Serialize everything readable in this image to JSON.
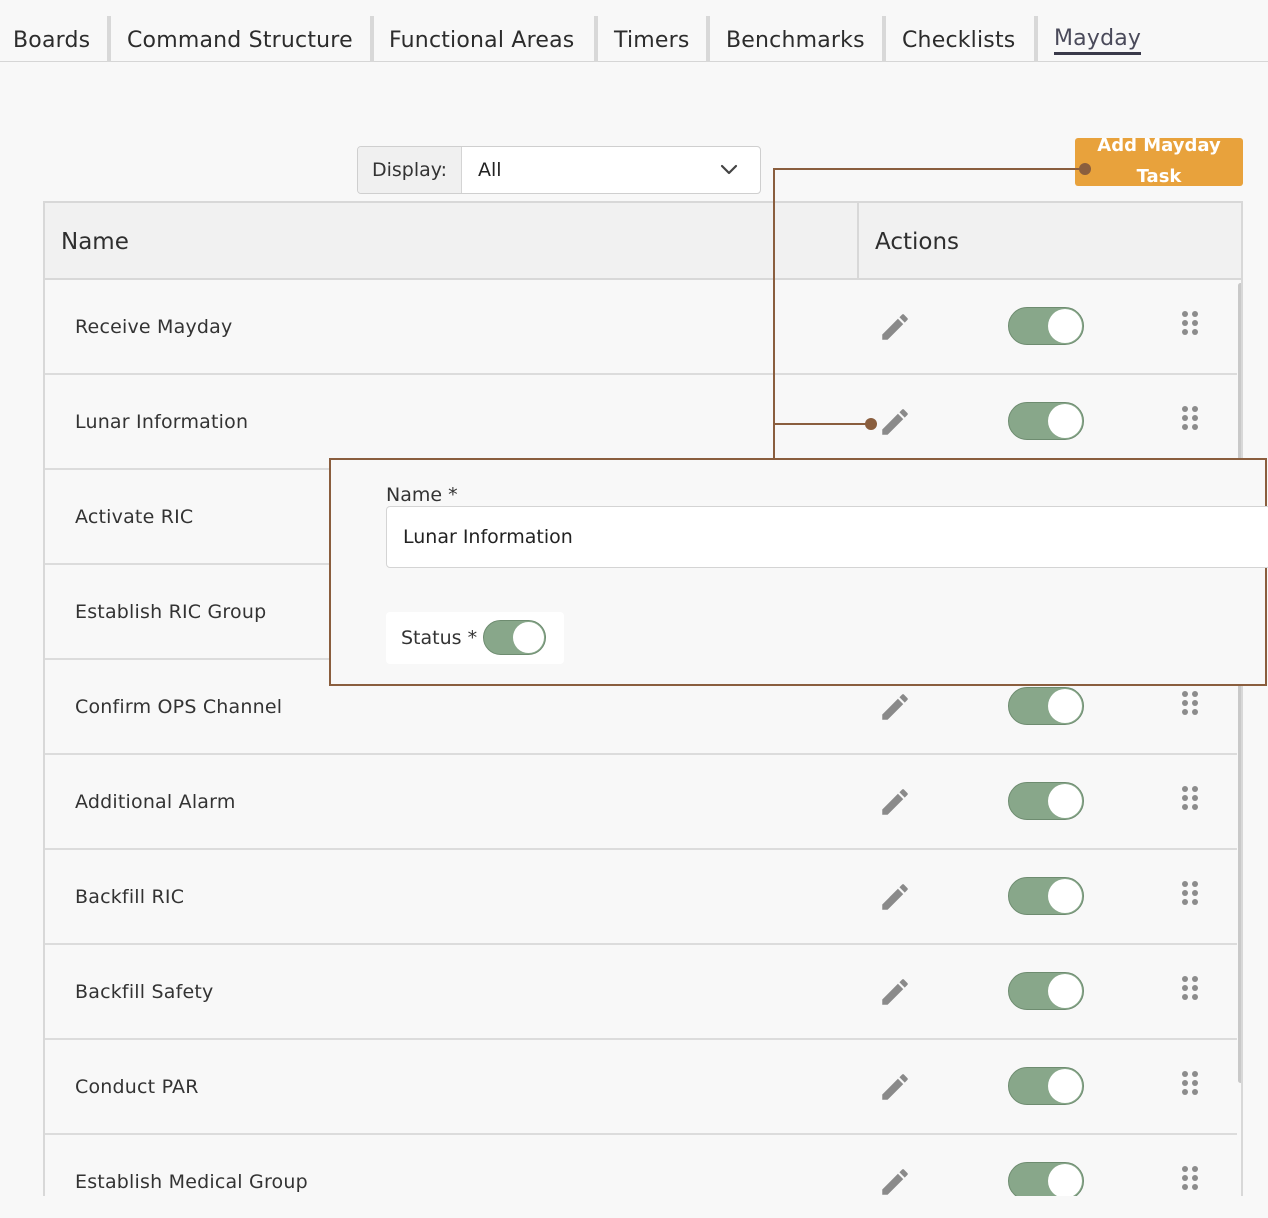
{
  "tabs": [
    {
      "label": "Boards"
    },
    {
      "label": "Command Structure"
    },
    {
      "label": "Functional Areas"
    },
    {
      "label": "Timers"
    },
    {
      "label": "Benchmarks"
    },
    {
      "label": "Checklists"
    },
    {
      "label": "Mayday",
      "active": true
    }
  ],
  "display": {
    "label": "Display:",
    "value": "All"
  },
  "add_button": {
    "label": "Add Mayday Task"
  },
  "table": {
    "headers": {
      "name": "Name",
      "actions": "Actions"
    },
    "rows": [
      {
        "name": "Receive Mayday",
        "enabled": true
      },
      {
        "name": "Lunar Information",
        "enabled": true
      },
      {
        "name": "Activate RIC",
        "enabled": true
      },
      {
        "name": "Establish RIC Group",
        "enabled": true
      },
      {
        "name": "Confirm OPS Channel",
        "enabled": true
      },
      {
        "name": "Additional Alarm",
        "enabled": true
      },
      {
        "name": "Backfill RIC",
        "enabled": true
      },
      {
        "name": "Backfill Safety",
        "enabled": true
      },
      {
        "name": "Conduct PAR",
        "enabled": true
      },
      {
        "name": "Establish Medical Group",
        "enabled": true
      }
    ]
  },
  "edit_form": {
    "name_label": "Name *",
    "name_value": "Lunar Information",
    "status_label": "Status *",
    "status_enabled": true
  },
  "colors": {
    "accent": "#e8a23c",
    "toggle_on": "#88a78a",
    "callout": "#8a5e3e"
  },
  "icons": {
    "edit": "pencil-icon",
    "drag": "drag-handle-icon",
    "dropdown": "chevron-down-icon"
  }
}
